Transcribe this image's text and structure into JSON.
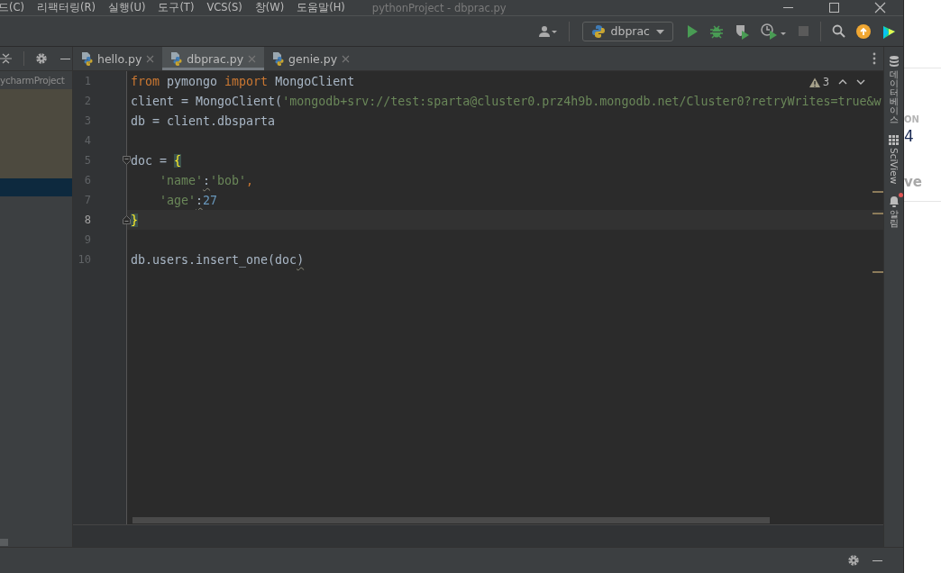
{
  "menu": [
    {
      "label": "드(C)"
    },
    {
      "label": "리팩터링(R)"
    },
    {
      "label": "실행(U)"
    },
    {
      "label": "도구(T)"
    },
    {
      "label": "VCS(S)"
    },
    {
      "label": "창(W)"
    },
    {
      "label": "도움말(H)"
    }
  ],
  "window": {
    "title": "pythonProject - dbprac.py"
  },
  "toolbar": {
    "run_config": "dbprac"
  },
  "project_panel": {
    "path_fragment": "ycharmProject"
  },
  "tabs": [
    {
      "label": "hello.py",
      "selected": false
    },
    {
      "label": "dbprac.py",
      "selected": true
    },
    {
      "label": "genie.py",
      "selected": false
    }
  ],
  "editor": {
    "problems_count": "3",
    "lines": [
      {
        "number": "1",
        "current": false,
        "tokens": [
          {
            "text": "from",
            "kind": "keyword"
          },
          {
            "text": " pymongo ",
            "kind": "plain"
          },
          {
            "text": "import",
            "kind": "keyword"
          },
          {
            "text": " MongoClient",
            "kind": "plain"
          }
        ]
      },
      {
        "number": "2",
        "current": false,
        "tokens": [
          {
            "text": "client = MongoClient(",
            "kind": "plain"
          },
          {
            "text": "'mongodb+srv://test:sparta@cluster0.prz4h9b.mongodb.net/Cluster0?retryWrites=true&w",
            "kind": "string"
          }
        ]
      },
      {
        "number": "3",
        "current": false,
        "tokens": [
          {
            "text": "db = client.dbsparta",
            "kind": "plain"
          }
        ]
      },
      {
        "number": "4",
        "current": false
      },
      {
        "number": "5",
        "current": false,
        "fold": {
          "kind": "start"
        },
        "tokens": [
          {
            "text": "doc = ",
            "kind": "plain"
          },
          {
            "text": "{",
            "kind": "brace_match"
          }
        ]
      },
      {
        "number": "6",
        "current": false,
        "tokens": [
          {
            "text": "    'name'",
            "kind": "string"
          },
          {
            "text": ":",
            "kind": "flagged"
          },
          {
            "text": "'bob'",
            "kind": "string"
          },
          {
            "text": ",",
            "kind": "keyword"
          }
        ]
      },
      {
        "number": "7",
        "current": false,
        "tokens": [
          {
            "text": "    'age'",
            "kind": "string"
          },
          {
            "text": ":",
            "kind": "flagged"
          },
          {
            "text": "27",
            "kind": "number"
          }
        ]
      },
      {
        "number": "8",
        "current": true,
        "fold": {
          "kind": "end"
        },
        "tokens": [
          {
            "text": "}",
            "kind": "brace_match"
          }
        ]
      },
      {
        "number": "9",
        "current": false
      },
      {
        "number": "10",
        "current": false,
        "tokens": [
          {
            "text": "db.users.insert_one(doc",
            "kind": "plain"
          },
          {
            "text": ")",
            "kind": "flagged"
          }
        ]
      }
    ]
  },
  "tool_windows": [
    {
      "label": "데이터베이스",
      "kind": "database",
      "unread": false
    },
    {
      "label": "SciView",
      "kind": "sciview",
      "unread": false
    },
    {
      "label": "알림",
      "kind": "notifications",
      "unread": true
    }
  ],
  "behind_window": {
    "texts": [
      "ON",
      "4",
      "ve"
    ]
  }
}
